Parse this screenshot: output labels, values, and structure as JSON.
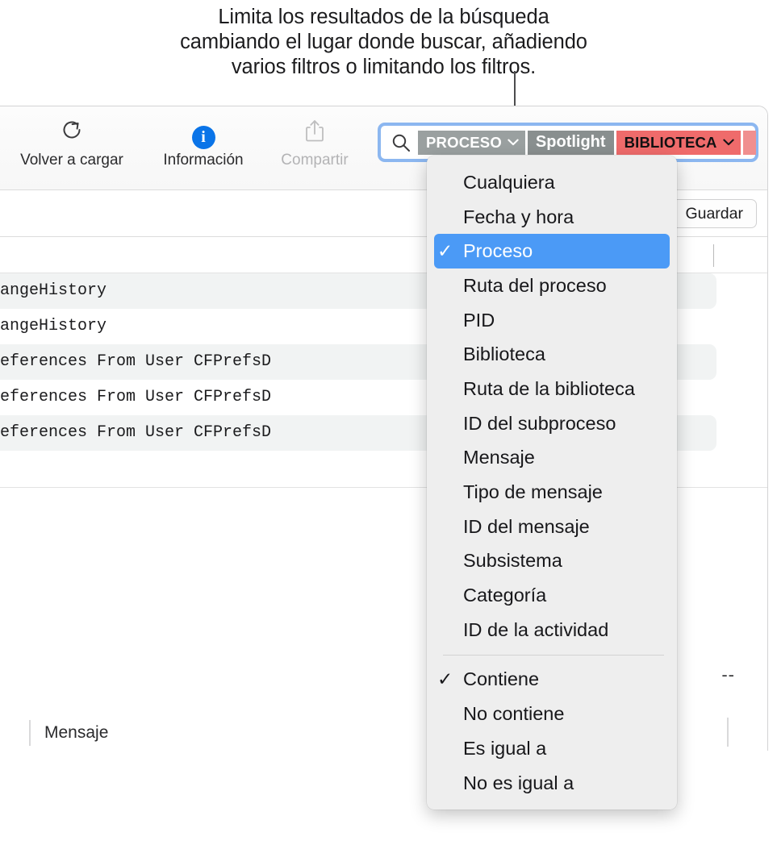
{
  "callout": {
    "line1": "Limita los resultados de la búsqueda",
    "line2": "cambiando el lugar donde buscar, añadiendo",
    "line3": "varios filtros o limitando los filtros."
  },
  "toolbar": {
    "items": [
      {
        "label": "Volver a cargar",
        "icon": "reload-icon",
        "enabled": true
      },
      {
        "label": "Información",
        "icon": "info-icon",
        "enabled": true
      },
      {
        "label": "Compartir",
        "icon": "share-icon",
        "enabled": false
      }
    ]
  },
  "search": {
    "icon": "search-icon",
    "tokens": [
      {
        "label": "PROCESO",
        "style": "gray",
        "caret": true
      },
      {
        "label": "Spotlight",
        "style": "gray-plain",
        "caret": false
      },
      {
        "label": "BIBLIOTECA",
        "style": "red",
        "caret": true
      }
    ]
  },
  "filter_bar": {
    "save_label": "Guardar"
  },
  "log": {
    "rows": [
      {
        "text": "angeHistory",
        "alt": true
      },
      {
        "text": "angeHistory",
        "alt": false
      },
      {
        "text": "eferences From User CFPrefsD",
        "alt": true
      },
      {
        "text": "eferences From User CFPrefsD",
        "alt": false
      },
      {
        "text": "eferences From User CFPrefsD",
        "alt": true
      }
    ]
  },
  "detail": {
    "dashes": "--",
    "column_label": "Mensaje"
  },
  "menu": {
    "field_options": [
      {
        "label": "Cualquiera",
        "checked": false,
        "selected": false
      },
      {
        "label": "Fecha y hora",
        "checked": false,
        "selected": false
      },
      {
        "label": "Proceso",
        "checked": true,
        "selected": true
      },
      {
        "label": "Ruta del proceso",
        "checked": false,
        "selected": false
      },
      {
        "label": "PID",
        "checked": false,
        "selected": false
      },
      {
        "label": "Biblioteca",
        "checked": false,
        "selected": false
      },
      {
        "label": "Ruta de la biblioteca",
        "checked": false,
        "selected": false
      },
      {
        "label": "ID del subproceso",
        "checked": false,
        "selected": false
      },
      {
        "label": "Mensaje",
        "checked": false,
        "selected": false
      },
      {
        "label": "Tipo de mensaje",
        "checked": false,
        "selected": false
      },
      {
        "label": "ID del mensaje",
        "checked": false,
        "selected": false
      },
      {
        "label": "Subsistema",
        "checked": false,
        "selected": false
      },
      {
        "label": "Categoría",
        "checked": false,
        "selected": false
      },
      {
        "label": "ID de la actividad",
        "checked": false,
        "selected": false
      }
    ],
    "match_options": [
      {
        "label": "Contiene",
        "checked": true,
        "selected": false
      },
      {
        "label": "No contiene",
        "checked": false,
        "selected": false
      },
      {
        "label": "Es igual a",
        "checked": false,
        "selected": false
      },
      {
        "label": "No es igual a",
        "checked": false,
        "selected": false
      }
    ],
    "check_glyph": "✓"
  },
  "colors": {
    "accent": "#4b9af6",
    "token_gray": "#9aa0a0",
    "token_red": "#ef6b6b",
    "info_badge": "#0a74e8",
    "focus_ring": "#8cb7f0"
  }
}
